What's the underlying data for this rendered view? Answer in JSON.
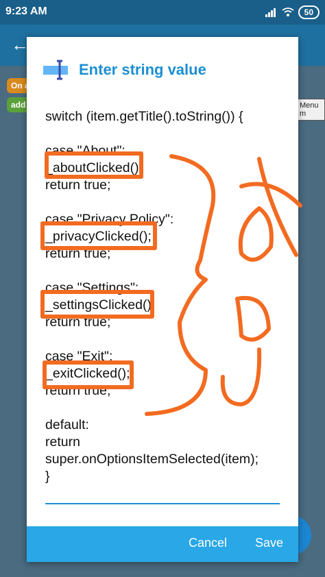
{
  "status_bar": {
    "time": "9:23 AM",
    "battery": "50"
  },
  "background": {
    "block_on": "On a",
    "block_add": "add",
    "block_menu": "Menu m"
  },
  "dialog": {
    "title": "Enter string value",
    "code_lines": [
      "switch (item.getTitle().toString()) {",
      "",
      "case \"About\":",
      "_aboutClicked();",
      "return true;",
      "",
      "case \"Privacy Policy\":",
      "_privacyClicked();",
      "return true;",
      "",
      "case \"Settings\":",
      "_settingsClicked();",
      "return true;",
      "",
      "case \"Exit\":",
      "_exitClicked();",
      "return true;",
      "",
      "default:",
      "return",
      "super.onOptionsItemSelected(item);",
      "}"
    ],
    "cancel_label": "Cancel",
    "save_label": "Save"
  },
  "colors": {
    "accent": "#1b8fd2",
    "footer": "#29a7e6",
    "annotation": "#f26b21"
  },
  "annotation_text": "To do"
}
